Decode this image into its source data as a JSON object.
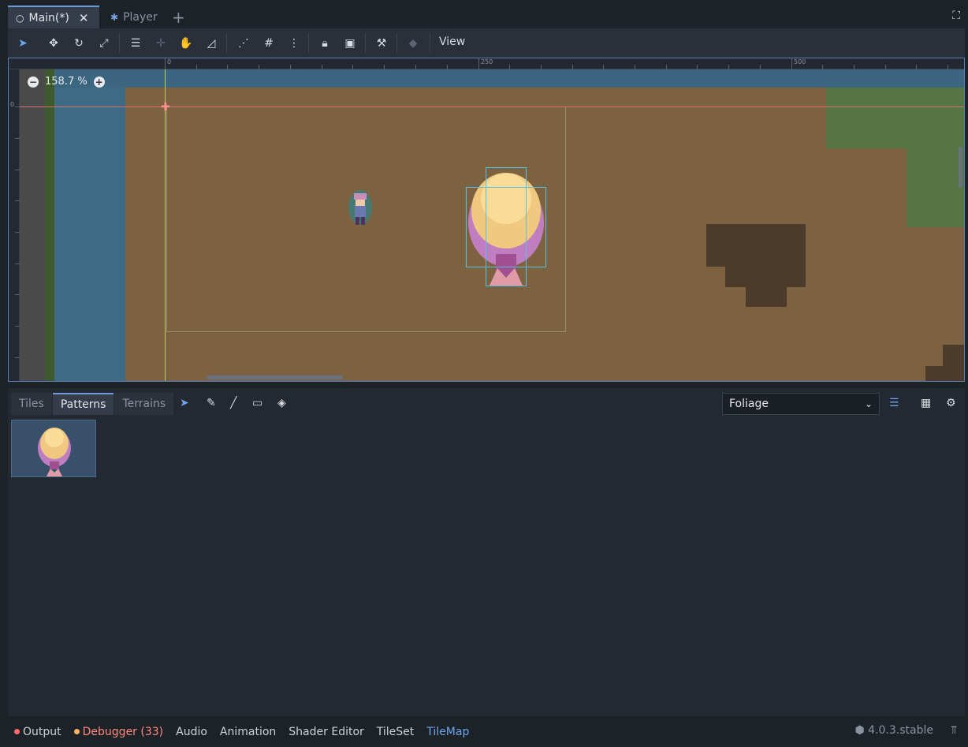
{
  "tabs": [
    {
      "label": "Main(*)",
      "icon": "node-circle-icon"
    },
    {
      "label": "Player",
      "icon": "node-character-icon"
    }
  ],
  "toolbar": {
    "view_label": "View",
    "icons": [
      "select-icon",
      "move-icon",
      "rotate-icon",
      "scale-icon",
      "list-select-icon",
      "pivot-icon",
      "pan-icon",
      "ruler-icon",
      "smart-snap-icon",
      "grid-snap-icon",
      "more-icon",
      "lock-icon",
      "group-icon",
      "bone-icon",
      "camera-override-icon"
    ]
  },
  "viewport": {
    "zoom_label": "158.7 %",
    "ruler_labels": [
      "0",
      "250",
      "500"
    ],
    "left_ruler_label": "0"
  },
  "tilemap_panel": {
    "tabs": [
      "Tiles",
      "Patterns",
      "Terrains"
    ],
    "active_tab": "Patterns",
    "tools": [
      "select-tool-icon",
      "paint-tool-icon",
      "line-tool-icon",
      "rect-tool-icon",
      "bucket-tool-icon"
    ],
    "layer_select": "Foliage",
    "pattern_count": 1
  },
  "statusbar": {
    "items": [
      {
        "label": "Output",
        "dot": "#ff6b6b"
      },
      {
        "label": "Debugger (33)",
        "dot": "#ffb060"
      },
      {
        "label": "Audio"
      },
      {
        "label": "Animation"
      },
      {
        "label": "Shader Editor"
      },
      {
        "label": "TileSet"
      },
      {
        "label": "TileMap"
      }
    ],
    "version": "4.0.3.stable"
  },
  "colors": {
    "accent": "#6ea5ee",
    "error": "#ff8a80",
    "dirt": "#7c6240",
    "water": "#3f6a83",
    "grass": "#557545"
  }
}
